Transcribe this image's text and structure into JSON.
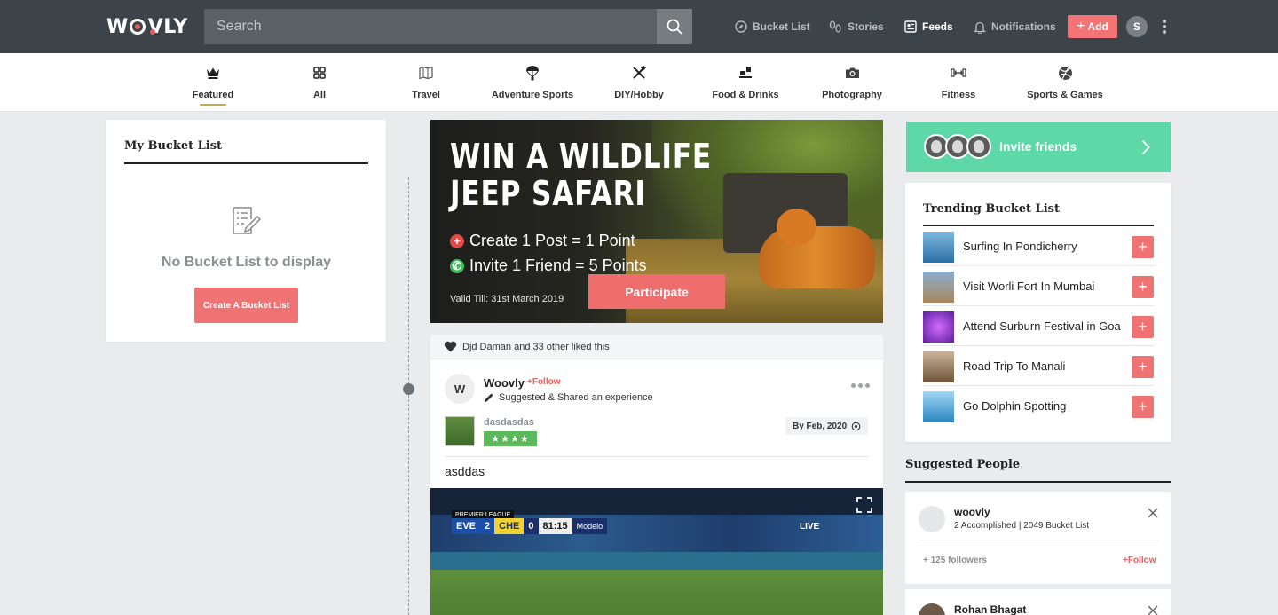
{
  "header": {
    "logo": "WOOVLY",
    "search_placeholder": "Search",
    "nav": [
      {
        "label": "Bucket List",
        "icon": "compass-icon"
      },
      {
        "label": "Stories",
        "icon": "footprints-icon"
      },
      {
        "label": "Feeds",
        "icon": "feeds-icon",
        "active": true
      },
      {
        "label": "Notifications",
        "icon": "bell-icon"
      }
    ],
    "add_label": "Add",
    "user_initial": "S"
  },
  "categories": [
    {
      "label": "Featured",
      "icon": "crown-icon",
      "active": true
    },
    {
      "label": "All",
      "icon": "grid-icon"
    },
    {
      "label": "Travel",
      "icon": "map-icon"
    },
    {
      "label": "Adventure Sports",
      "icon": "parachute-icon"
    },
    {
      "label": "DIY/Hobby",
      "icon": "tools-icon"
    },
    {
      "label": "Food & Drinks",
      "icon": "food-icon"
    },
    {
      "label": "Photography",
      "icon": "camera-icon"
    },
    {
      "label": "Fitness",
      "icon": "dumbbell-icon"
    },
    {
      "label": "Sports & Games",
      "icon": "ball-icon"
    }
  ],
  "my_bucket": {
    "title": "My Bucket List",
    "empty_text": "No Bucket List to display",
    "create_label": "Create A Bucket List"
  },
  "banner": {
    "headline_1": "WIN A WILDLIFE",
    "headline_2": "JEEP SAFARI",
    "line_1": "Create 1 Post = 1 Point",
    "line_2": "Invite 1 Friend = 5 Points",
    "valid": "Valid Till: 31st March 2019",
    "participate_label": "Participate"
  },
  "post": {
    "likes_text": "Djd Daman and 33 other liked this",
    "avatar_initial": "W",
    "author": "Woovly",
    "follow_label": "+Follow",
    "subtitle": "Suggested & Shared an experience",
    "bucket_name": "dasdasdas",
    "stars": "★★★★",
    "date": "By Feb, 2020",
    "text": "asddas",
    "video": {
      "league": "PREMIER LEAGUE",
      "home": "EVE",
      "home_score": "2",
      "away": "CHE",
      "away_score": "0",
      "clock": "81:15",
      "sponsor": "Modelo",
      "live": "LIVE"
    }
  },
  "invite": {
    "label": "Invite friends"
  },
  "trending": {
    "title": "Trending Bucket List",
    "items": [
      {
        "name": "Surfing In Pondicherry",
        "color": "#4a8fc2"
      },
      {
        "name": "Visit Worli Fort In Mumbai",
        "color": "#a9875a"
      },
      {
        "name": "Attend Surburn Festival in Goa",
        "color": "#7a3fc0"
      },
      {
        "name": "Road Trip To Manali",
        "color": "#9a7a58"
      },
      {
        "name": "Go Dolphin Spotting",
        "color": "#3f9ed4"
      }
    ]
  },
  "suggested": {
    "title": "Suggested People",
    "people": [
      {
        "name": "woovly",
        "meta": "2 Accomplished | 2049 Bucket List",
        "followers": "+ 125 followers",
        "follow": "+Follow"
      },
      {
        "name": "Rohan Bhagat"
      }
    ]
  },
  "colors": {
    "accent": "#f07373",
    "topbar": "#3d4449",
    "invite": "#5fd8a8",
    "featured_underline": "#d6aa2f"
  }
}
